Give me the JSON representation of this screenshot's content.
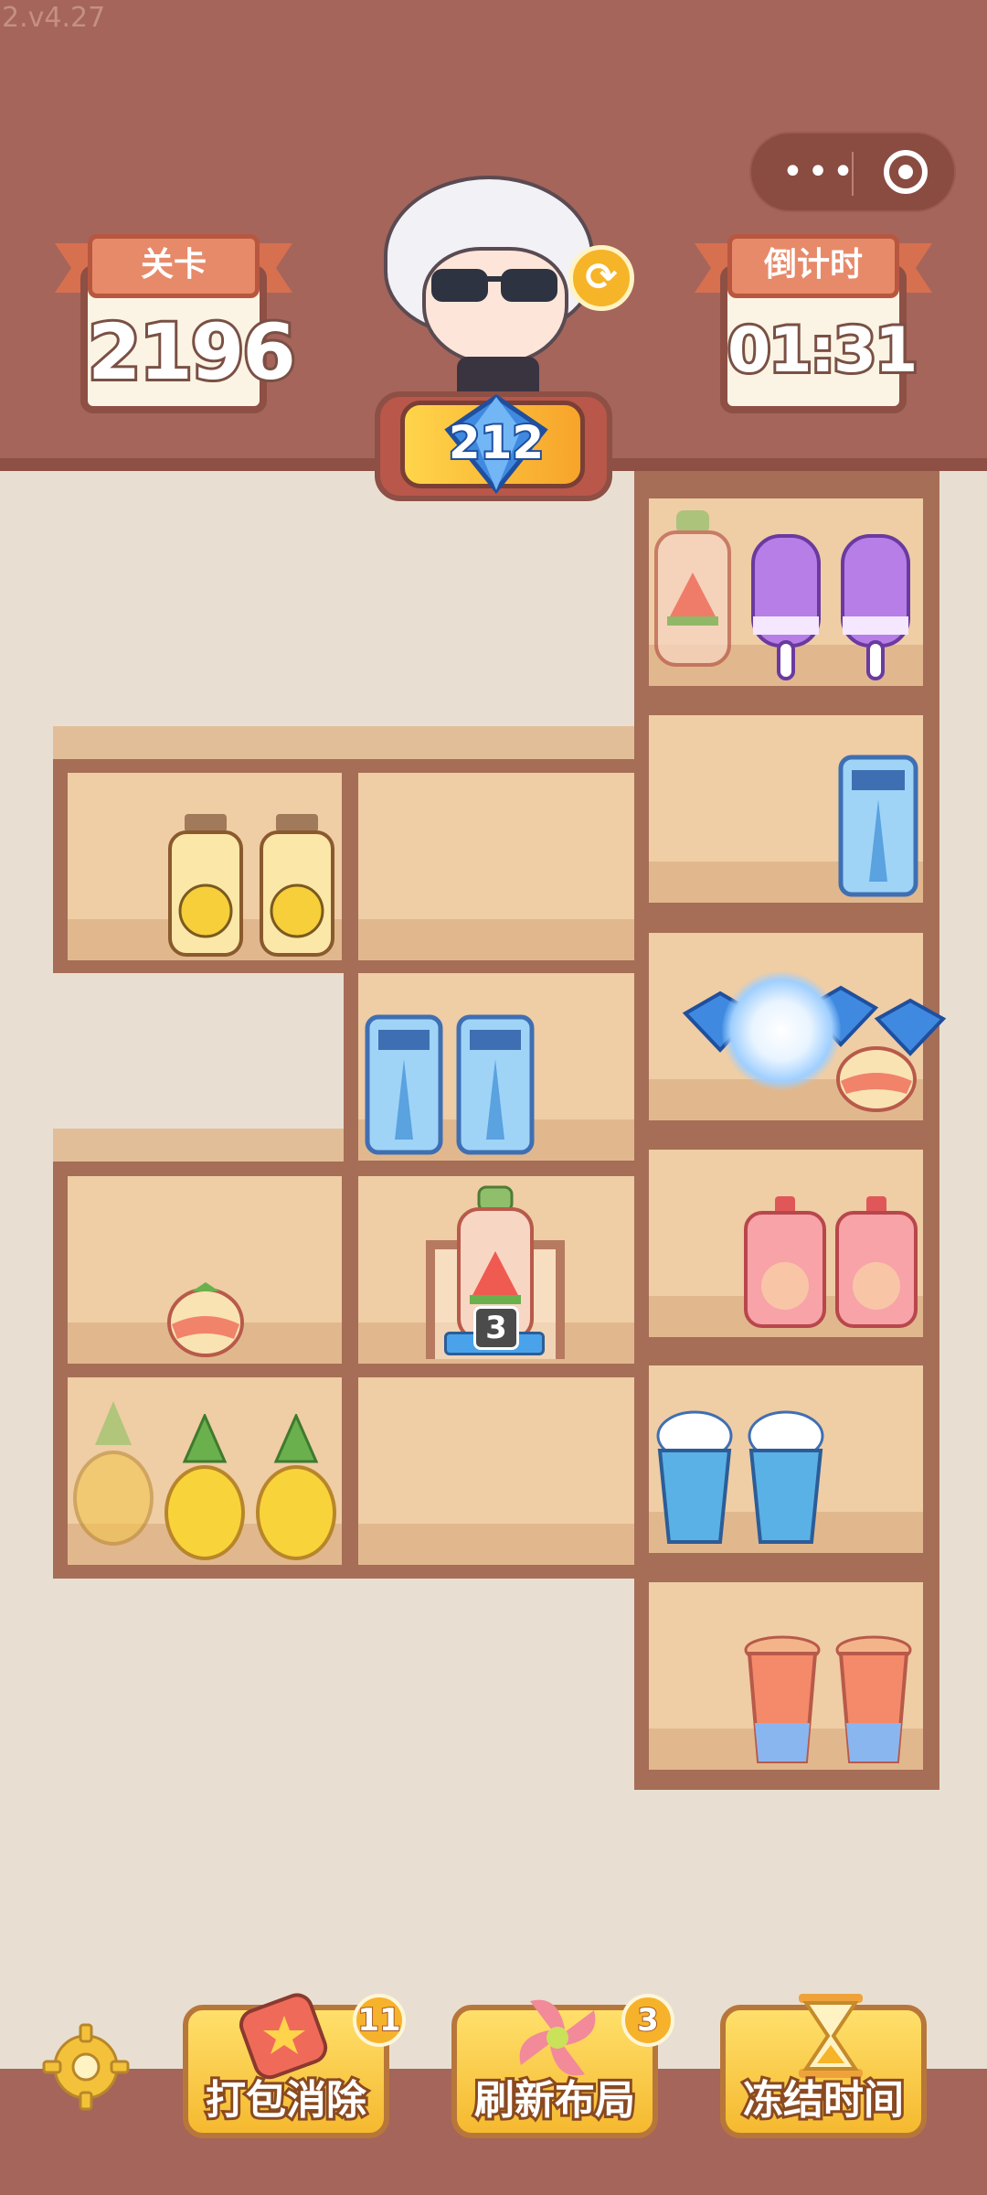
{
  "app": {
    "version": "2.v4.27"
  },
  "hud": {
    "level": {
      "label": "关卡",
      "value": "2196"
    },
    "timer": {
      "label": "倒计时",
      "value": "01:31"
    },
    "gems": {
      "value": "212"
    }
  },
  "capsule": {
    "more": "•••"
  },
  "board": {
    "stack_count": "3"
  },
  "tools": [
    {
      "label": "打包消除",
      "count": "11"
    },
    {
      "label": "刷新布局",
      "count": "3"
    },
    {
      "label": "冻结时间",
      "count": ""
    }
  ],
  "colors": {
    "header_bg": "#a5655a",
    "shelf_wood": "#a66e56",
    "button_yellow": "#f5b92f",
    "accent_blue": "#4aa3ea"
  }
}
